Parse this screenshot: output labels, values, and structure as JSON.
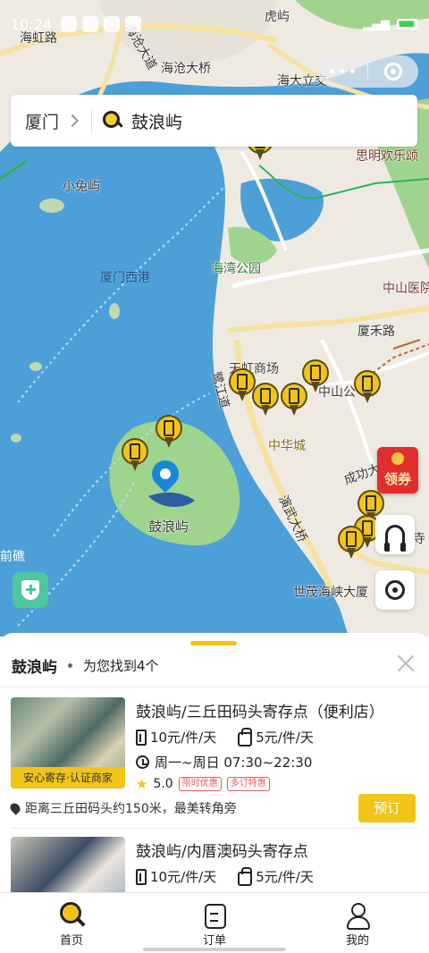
{
  "status_bar": {
    "time": "10:24"
  },
  "map": {
    "labels": {
      "hongshan": "虎屿",
      "haihong": "海虹路",
      "haicang_dadao": "海沧大道",
      "haicang_bridge": "海沧大桥",
      "haida": "海大立交",
      "siming": "思明欢乐颂",
      "xiaotu": "小兔屿",
      "xigang": "厦门西港",
      "haiwan": "海湾公园",
      "zhongshan_hosp": "中山医院",
      "xiahe": "厦禾路",
      "tianhong": "天虹商场",
      "zhongshan_park": "中山公",
      "lujiang": "鹭江道",
      "zhonghua": "中华城",
      "chenggong": "成功大",
      "gulangyu": "鼓浪屿",
      "yanwu": "演武大桥",
      "si": "寺",
      "qianjiao": "前礁",
      "shimao": "世茂海峡大厦"
    },
    "coupon_label": "领券"
  },
  "search": {
    "city": "厦门",
    "query": "鼓浪屿"
  },
  "sheet": {
    "title": "鼓浪屿",
    "count_text": "为您找到4个",
    "cards": [
      {
        "title": "鼓浪屿/三丘田码头寄存点（便利店）",
        "price_large": "10元/件/天",
        "price_small": "5元/件/天",
        "hours": "周一~周日 07:30~22:30",
        "rating": "5.0",
        "tags": [
          "限时优惠",
          "多订特惠"
        ],
        "badge": "安心寄存·认证商家",
        "address": "距离三丘田码头约150米，最美转角旁",
        "book_label": "预订"
      },
      {
        "title": "鼓浪屿/内厝澳码头寄存点",
        "price_large": "10元/件/天",
        "price_small": "5元/件/天"
      }
    ]
  },
  "tabbar": {
    "items": [
      {
        "label": "首页",
        "icon": "search-icon"
      },
      {
        "label": "订单",
        "icon": "order-icon"
      },
      {
        "label": "我的",
        "icon": "user-icon"
      }
    ]
  },
  "colors": {
    "accent": "#f2c418",
    "water": "#4d9fd8",
    "land": "#eeeae2",
    "green": "#9fd48f"
  }
}
